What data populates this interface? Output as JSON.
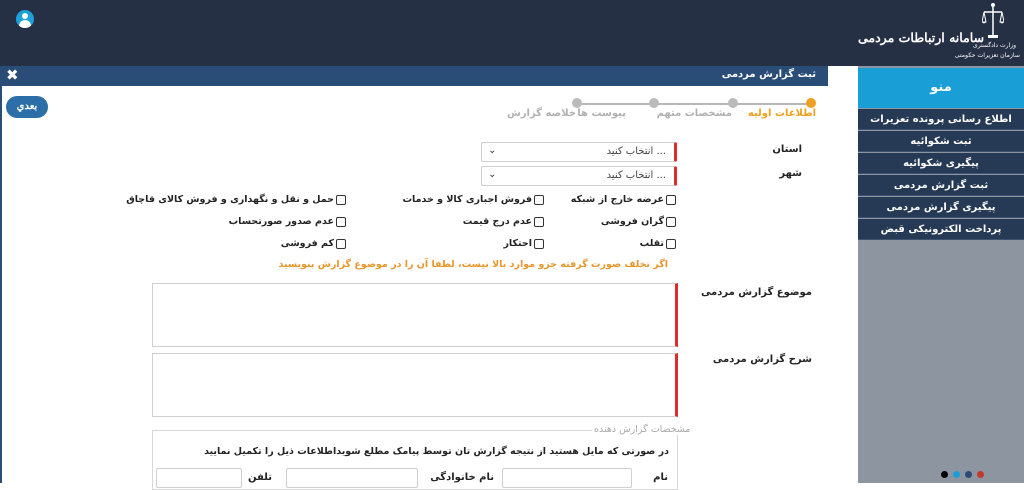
{
  "header": {
    "brand_title": "سامانه ارتباطات مردمی",
    "logo_line1": "وزارت دادگستری",
    "logo_line2": "سازمان تعزیرات حکومتی"
  },
  "panel": {
    "title": "ثبت گزارش مردمی",
    "close": "✖",
    "next_button": "بعدي"
  },
  "steps": [
    {
      "label": "اطلاعات اولیه",
      "active": true
    },
    {
      "label": "مشخصات متهم",
      "active": false
    },
    {
      "label": "پیوست ها",
      "active": false
    },
    {
      "label": "خلاصه گزارش",
      "active": false
    }
  ],
  "form": {
    "province_label": "استان",
    "province_value": "انتخاب کنید ...",
    "city_label": "شهر",
    "city_value": "انتخاب کنید ...",
    "checkboxes": [
      "عرضه خارج از شبکه",
      "فروش اجباری کالا و خدمات",
      "حمل و نقل و نگهداری و فروش کالای قاچاق",
      "گران فروشی",
      "عدم درج قیمت",
      "عدم صدور صورتحساب",
      "تقلب",
      "احتکار",
      "کم فروشی"
    ],
    "warning": "اگر تخلف صورت گرفته جزو موارد بالا نیست، لطفا آن را در موضوع گزارش بنویسید",
    "subject_label": "موضوع گزارش مردمی",
    "description_label": "شرح گزارش مردمی",
    "reporter_legend": "مشخصات گزارش دهنده",
    "reporter_note": "در صورتی که مایل هستید از نتیجه گزارش تان توسط پیامک مطلع شویداطلاعات ذیل را تکمیل نمایید",
    "first_name_label": "نام",
    "last_name_label": "نام خانوادگی",
    "phone_label": "تلفن"
  },
  "sidebar": {
    "title": "منو",
    "items": [
      "اطلاع رسانی پرونده تعزیرات",
      "ثبت شکوائیه",
      "پیگیری شکوائیه",
      "ثبت گزارش مردمی",
      "پیگیری گزارش مردمی",
      "پرداخت الکترونیکی قبض"
    ],
    "dot_colors": [
      "#000000",
      "#1a9ed6",
      "#2a4d78",
      "#c0392b"
    ]
  },
  "colors": {
    "accent": "#1a9ed6",
    "header": "#263045",
    "active_step": "#f0a020",
    "required": "#e02b2b"
  }
}
